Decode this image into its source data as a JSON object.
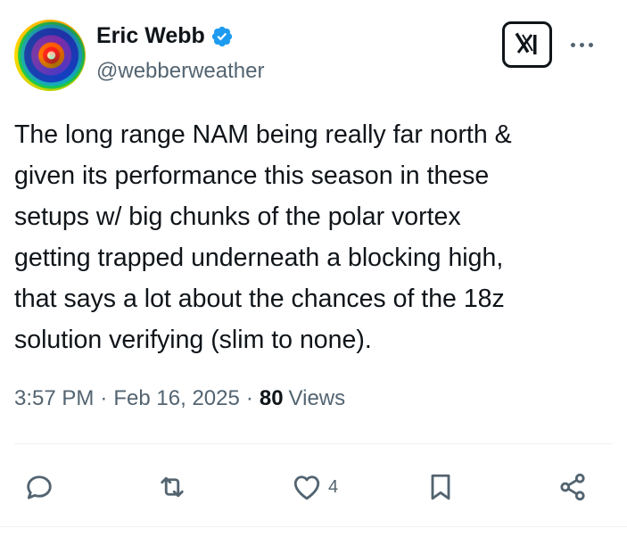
{
  "author": {
    "name": "Eric Webb",
    "handle": "@webberweather",
    "verified_color": "#1d9bf0"
  },
  "tweet": {
    "text": "The long range NAM being really far north &\ngiven its performance this season in these\nsetups w/ big chunks of the polar vortex\ngetting trapped underneath a blocking high,\nthat says a lot about the chances of the 18z\nsolution verifying (slim to none).",
    "time": "3:57 PM",
    "date": "Feb 16, 2025",
    "views_count": "80",
    "views_label": "Views"
  },
  "actions": {
    "reply_icon": "reply-icon",
    "retweet_icon": "retweet-icon",
    "like_icon": "heart-icon",
    "like_count": "4",
    "bookmark_icon": "bookmark-icon",
    "share_icon": "share-icon"
  },
  "colors": {
    "text": "#0f1419",
    "secondary": "#536471",
    "action_icon": "#536471"
  }
}
